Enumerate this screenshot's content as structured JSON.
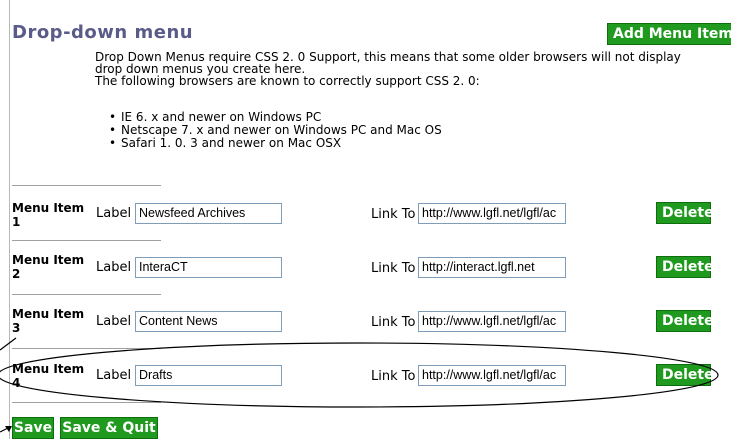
{
  "page": {
    "title": "Drop-down menu",
    "add_button": "Add Menu Item"
  },
  "intro": {
    "line1": "Drop Down Menus require CSS 2. 0 Support, this means that some older browsers will not display",
    "line2": "drop down menus you create here.",
    "line3": "The following browsers are known to correctly support CSS 2. 0:",
    "browsers": [
      "IE 6. x and newer on Windows PC",
      "Netscape 7. x and newer on Windows PC and Mac OS",
      "Safari 1. 0. 3 and newer on Mac OSX"
    ]
  },
  "fields": {
    "label_text": "Label",
    "link_text": "Link To",
    "delete_text": "Delete"
  },
  "items": [
    {
      "title_line1": "Menu Item",
      "title_line2": "1",
      "label": "Newsfeed Archives",
      "link": "http://www.lgfl.net/lgfl/ac"
    },
    {
      "title_line1": "Menu Item",
      "title_line2": "2",
      "label": "InteraCT",
      "link": "http://interact.lgfl.net"
    },
    {
      "title_line1": "Menu Item",
      "title_line2": "3",
      "label": "Content News",
      "link": "http://www.lgfl.net/lgfl/ac"
    },
    {
      "title_line1": "Menu Item",
      "title_line2": "4",
      "label": "Drafts",
      "link": "http://www.lgfl.net/lgfl/ac"
    }
  ],
  "footer": {
    "save": "Save",
    "save_quit": "Save & Quit"
  },
  "colors": {
    "accent_green": "#1f9a1f",
    "title_color": "#5b5b8a"
  }
}
